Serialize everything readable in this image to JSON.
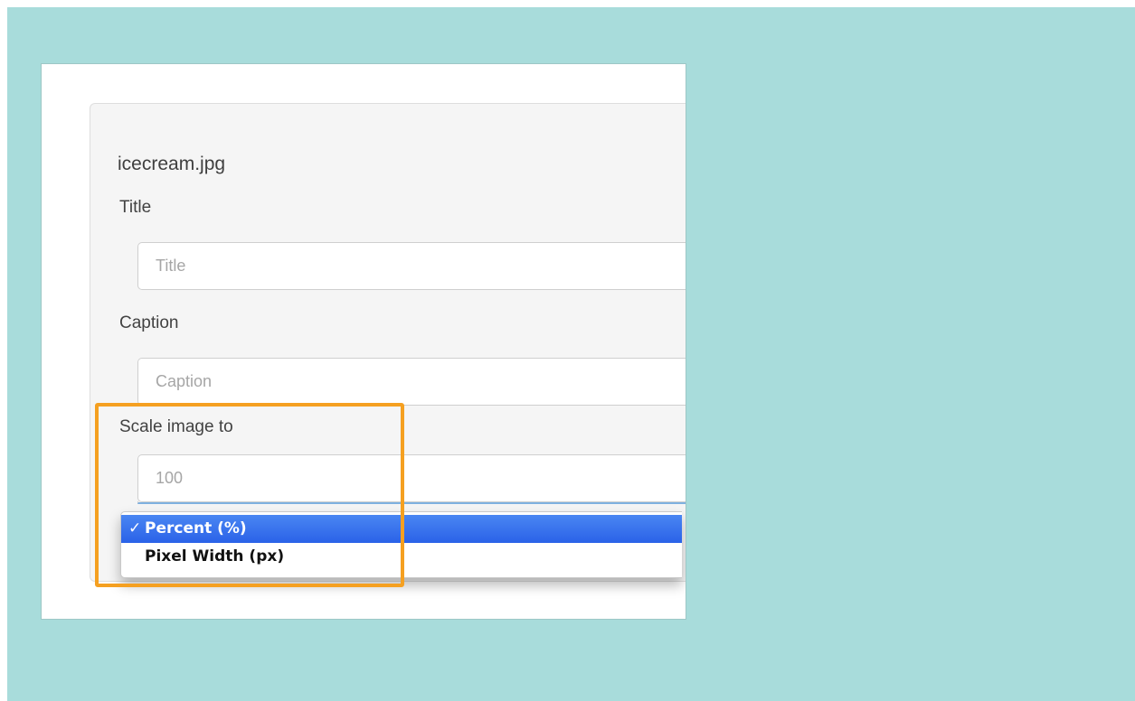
{
  "file": {
    "name": "icecream.jpg"
  },
  "title_field": {
    "label": "Title",
    "placeholder": "Title",
    "value": ""
  },
  "caption_field": {
    "label": "Caption",
    "placeholder": "Caption",
    "value": ""
  },
  "scale_field": {
    "label": "Scale image to",
    "placeholder": "100",
    "value": "",
    "unit_options": [
      {
        "check": "✓",
        "label": "Percent (%)",
        "selected": true
      },
      {
        "check": "",
        "label": "Pixel Width (px)",
        "selected": false
      }
    ]
  },
  "colors": {
    "background": "#a8dcdb",
    "highlight": "#f5a021",
    "selected_option": "#2f6ae9"
  }
}
